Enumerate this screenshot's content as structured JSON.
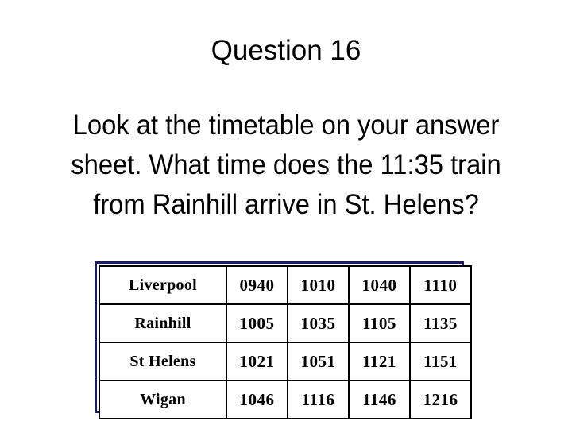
{
  "slide": {
    "title": "Question 16",
    "question_lines": [
      "Look at the timetable on your answer",
      "sheet. What time does the 11:35 train",
      "from Rainhill arrive in St. Helens?"
    ],
    "colors": {
      "text": "#000000",
      "background": "#ffffff",
      "table_outer_border": "#1a1a6e",
      "table_cell_border": "#000000"
    }
  },
  "timetable": {
    "rows": [
      {
        "station": "Liverpool",
        "times": [
          "0940",
          "1010",
          "1040",
          "1110"
        ]
      },
      {
        "station": "Rainhill",
        "times": [
          "1005",
          "1035",
          "1105",
          "1135"
        ]
      },
      {
        "station": "St Helens",
        "times": [
          "1021",
          "1051",
          "1121",
          "1151"
        ]
      },
      {
        "station": "Wigan",
        "times": [
          "1046",
          "1116",
          "1146",
          "1216"
        ]
      }
    ]
  }
}
